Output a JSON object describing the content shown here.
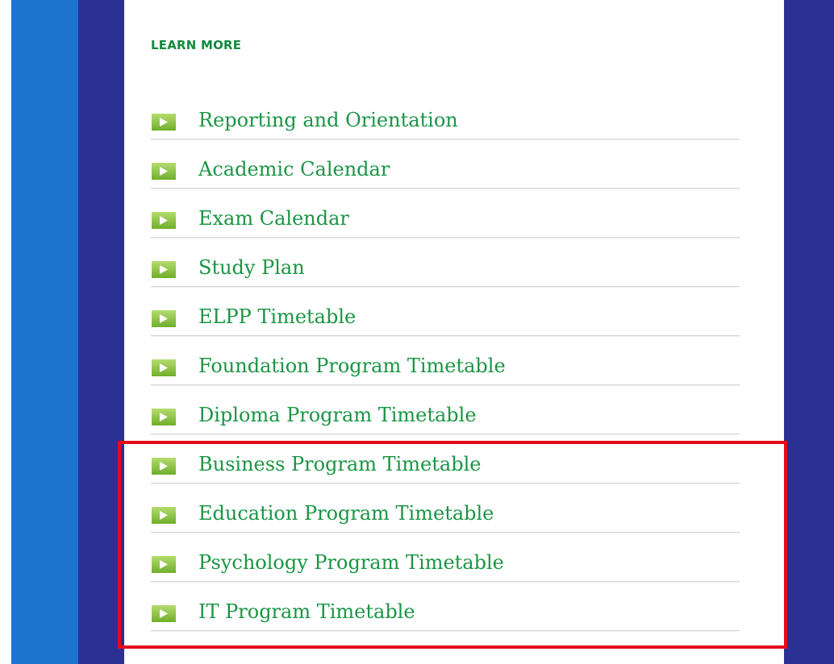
{
  "colors": {
    "stripe_light": "#1e74cf",
    "stripe_dark": "#2a3192",
    "link_green": "#1a9544",
    "heading_green": "#118a3d",
    "highlight_red": "#e5081d"
  },
  "learn_more": {
    "heading": "LEARN MORE",
    "links": [
      {
        "label": "Reporting and Orientation",
        "icon": "play-arrow-icon"
      },
      {
        "label": "Academic Calendar",
        "icon": "play-arrow-icon"
      },
      {
        "label": "Exam Calendar",
        "icon": "play-arrow-icon"
      },
      {
        "label": "Study Plan",
        "icon": "play-arrow-icon"
      },
      {
        "label": "ELPP Timetable",
        "icon": "play-arrow-icon"
      },
      {
        "label": "Foundation Program Timetable",
        "icon": "play-arrow-icon"
      },
      {
        "label": "Diploma Program Timetable",
        "icon": "play-arrow-icon"
      },
      {
        "label": "Business Program Timetable",
        "icon": "play-arrow-icon"
      },
      {
        "label": "Education Program Timetable",
        "icon": "play-arrow-icon"
      },
      {
        "label": "Psychology Program Timetable",
        "icon": "play-arrow-icon"
      },
      {
        "label": "IT Program Timetable",
        "icon": "play-arrow-icon"
      }
    ]
  }
}
